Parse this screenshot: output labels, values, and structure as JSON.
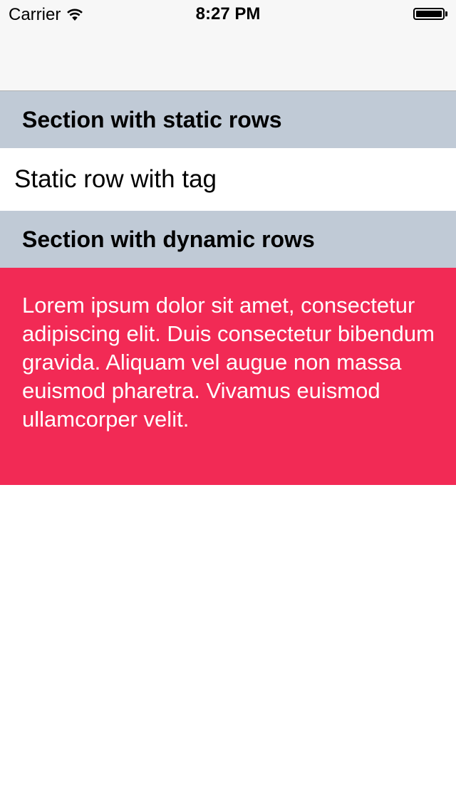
{
  "status_bar": {
    "carrier": "Carrier",
    "time": "8:27 PM",
    "battery_level": 1.0,
    "wifi_icon": "wifi-icon",
    "battery_icon": "battery-icon"
  },
  "sections": [
    {
      "header": "Section with static rows",
      "rows": [
        "Static row with tag"
      ]
    },
    {
      "header": "Section with dynamic rows",
      "rows": [
        "Lorem ipsum dolor sit amet, consectetur adipiscing elit. Duis consectetur bibendum gravida. Aliquam vel augue non massa euismod pharetra. Vivamus euismod ullamcorper velit."
      ]
    }
  ],
  "colors": {
    "header_background": "#c0cad6",
    "dynamic_row_background": "#f22a55",
    "nav_background": "#f7f7f7"
  }
}
